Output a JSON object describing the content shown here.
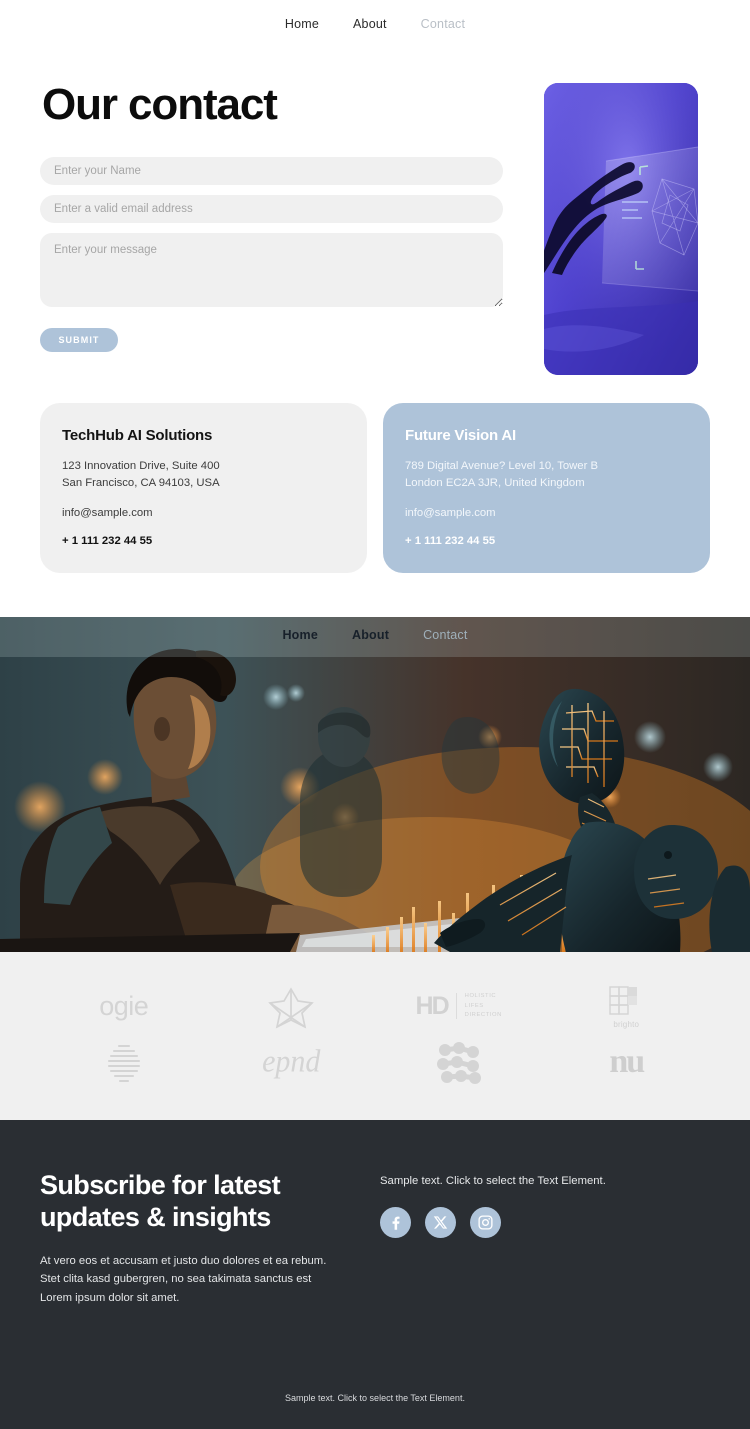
{
  "nav": {
    "items": [
      {
        "label": "Home",
        "muted": false
      },
      {
        "label": "About",
        "muted": false
      },
      {
        "label": "Contact",
        "muted": true
      }
    ]
  },
  "contact": {
    "title": "Our contact",
    "form": {
      "name_placeholder": "Enter your Name",
      "email_placeholder": "Enter a valid email address",
      "message_placeholder": "Enter your message",
      "name_value": "",
      "email_value": "",
      "message_value": "",
      "submit_label": "SUBMIT"
    },
    "hero_image_alt": "hand-touching-glass-interface"
  },
  "cards": [
    {
      "title": "TechHub AI Solutions",
      "address_line1": "123 Innovation Drive, Suite 400",
      "address_line2": "San Francisco, CA 94103, USA",
      "email": "info@sample.com",
      "phone": "+ 1 111 232 44 55",
      "style": "light"
    },
    {
      "title": "Future Vision AI",
      "address_line1": "789 Digital Avenue? Level 10, Tower B",
      "address_line2": "London EC2A 3JR, United Kingdom",
      "email": "info@sample.com",
      "phone": "+ 1 111 232 44 55",
      "style": "blue"
    }
  ],
  "band": {
    "nav": [
      {
        "label": "Home",
        "muted": false
      },
      {
        "label": "About",
        "muted": false
      },
      {
        "label": "Contact",
        "muted": true
      }
    ],
    "image_alt": "woman-working-with-robot"
  },
  "logos": {
    "row1": [
      {
        "name": "ogie",
        "kind": "word"
      },
      {
        "name": "star",
        "kind": "mark"
      },
      {
        "name": "HD",
        "kind": "hd",
        "lines": [
          "HOLISTIC",
          "LIFES",
          "DIRECTION"
        ]
      },
      {
        "name": "brighto",
        "kind": "brighto",
        "label": "brighto"
      }
    ],
    "row2": [
      {
        "name": "globe",
        "kind": "mark"
      },
      {
        "name": "epnd",
        "kind": "word"
      },
      {
        "name": "dots",
        "kind": "mark"
      },
      {
        "name": "nu",
        "kind": "word"
      }
    ]
  },
  "footer": {
    "title": "Subscribe for latest updates & insights",
    "body_line1": "At vero eos et accusam et justo duo dolores et ea rebum.",
    "body_line2": "Stet clita kasd gubergren, no sea takimata sanctus est",
    "body_line3": "Lorem ipsum dolor sit amet.",
    "sample_text": "Sample text. Click to select the Text Element.",
    "social": [
      {
        "name": "facebook",
        "label": "f"
      },
      {
        "name": "x-twitter",
        "label": "X"
      },
      {
        "name": "instagram",
        "label": "ig"
      }
    ],
    "bottom_text": "Sample text. Click to select the Text Element."
  },
  "colors": {
    "accent_blue": "#aec3d9",
    "light_gray": "#f0f0f0",
    "footer_dark": "#2a2e33",
    "muted_nav": "#b9bfc6"
  }
}
